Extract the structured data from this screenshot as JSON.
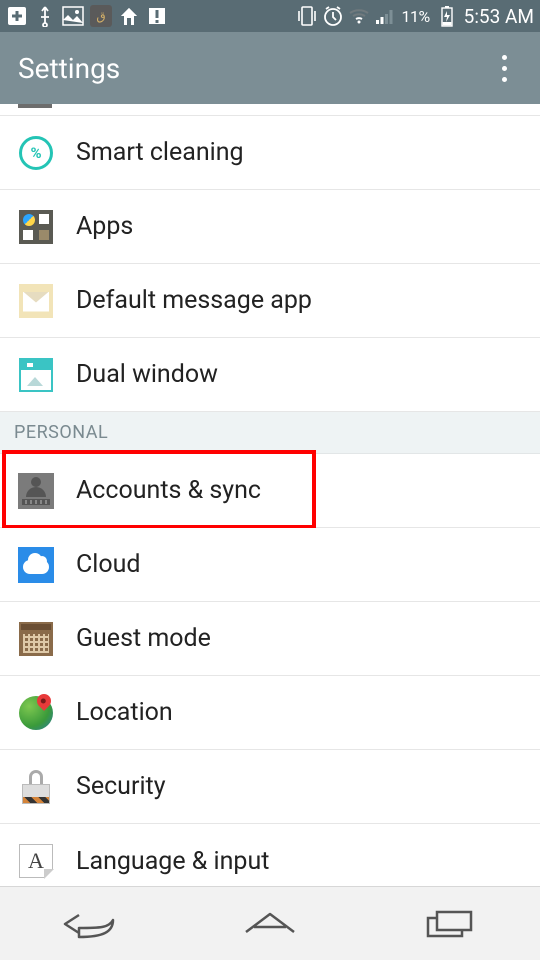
{
  "status_bar": {
    "battery_percent": "11%",
    "clock": "5:53 AM"
  },
  "app_bar": {
    "title": "Settings"
  },
  "sections": {
    "personal_header": "PERSONAL"
  },
  "rows": {
    "smart_cleaning": "Smart cleaning",
    "apps": "Apps",
    "default_message_app": "Default message app",
    "dual_window": "Dual window",
    "accounts_sync": "Accounts & sync",
    "cloud": "Cloud",
    "guest_mode": "Guest mode",
    "location": "Location",
    "security": "Security",
    "language_input": "Language & input"
  },
  "lang_icon_letter": "A",
  "smartclean_symbol": "%"
}
